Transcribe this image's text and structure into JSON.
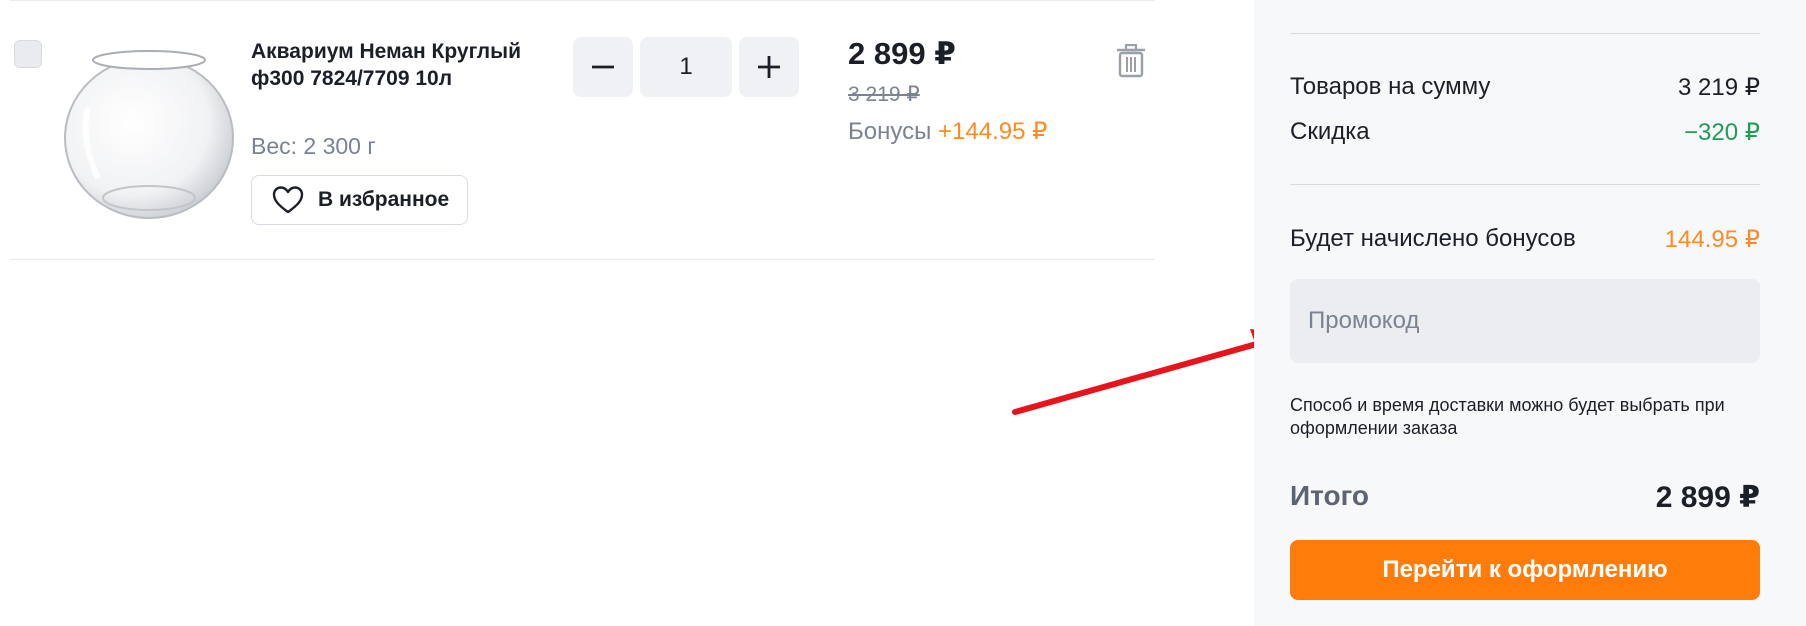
{
  "product": {
    "title": "Аквариум Неман Круглый ф300 7824/7709 10л",
    "weight": "Вес: 2 300 г",
    "favorite_label": "В избранное",
    "quantity": "1",
    "price": "2 899 ₽",
    "old_price": "3 219 ₽",
    "bonus_label": "Бонусы",
    "bonus_value": "+144.95 ₽"
  },
  "summary": {
    "goods_label": "Товаров на сумму",
    "goods_value": "3 219 ₽",
    "discount_label": "Скидка",
    "discount_value": "−320 ₽",
    "bonus_label": "Будет начислено бонусов",
    "bonus_value": "144.95 ₽",
    "promo_placeholder": "Промокод",
    "delivery_note": "Способ и время доставки можно будет выбрать при оформлении заказа",
    "total_label": "Итого",
    "total_value": "2 899 ₽",
    "checkout_label": "Перейти к оформлению"
  },
  "colors": {
    "accent": "#ff7c0a",
    "bonus": "#ff8a1f",
    "discount": "#1f9d55",
    "annotation_arrow": "#e8141b"
  },
  "icons": [
    "heart-icon",
    "minus-icon",
    "plus-icon",
    "trash-icon"
  ]
}
